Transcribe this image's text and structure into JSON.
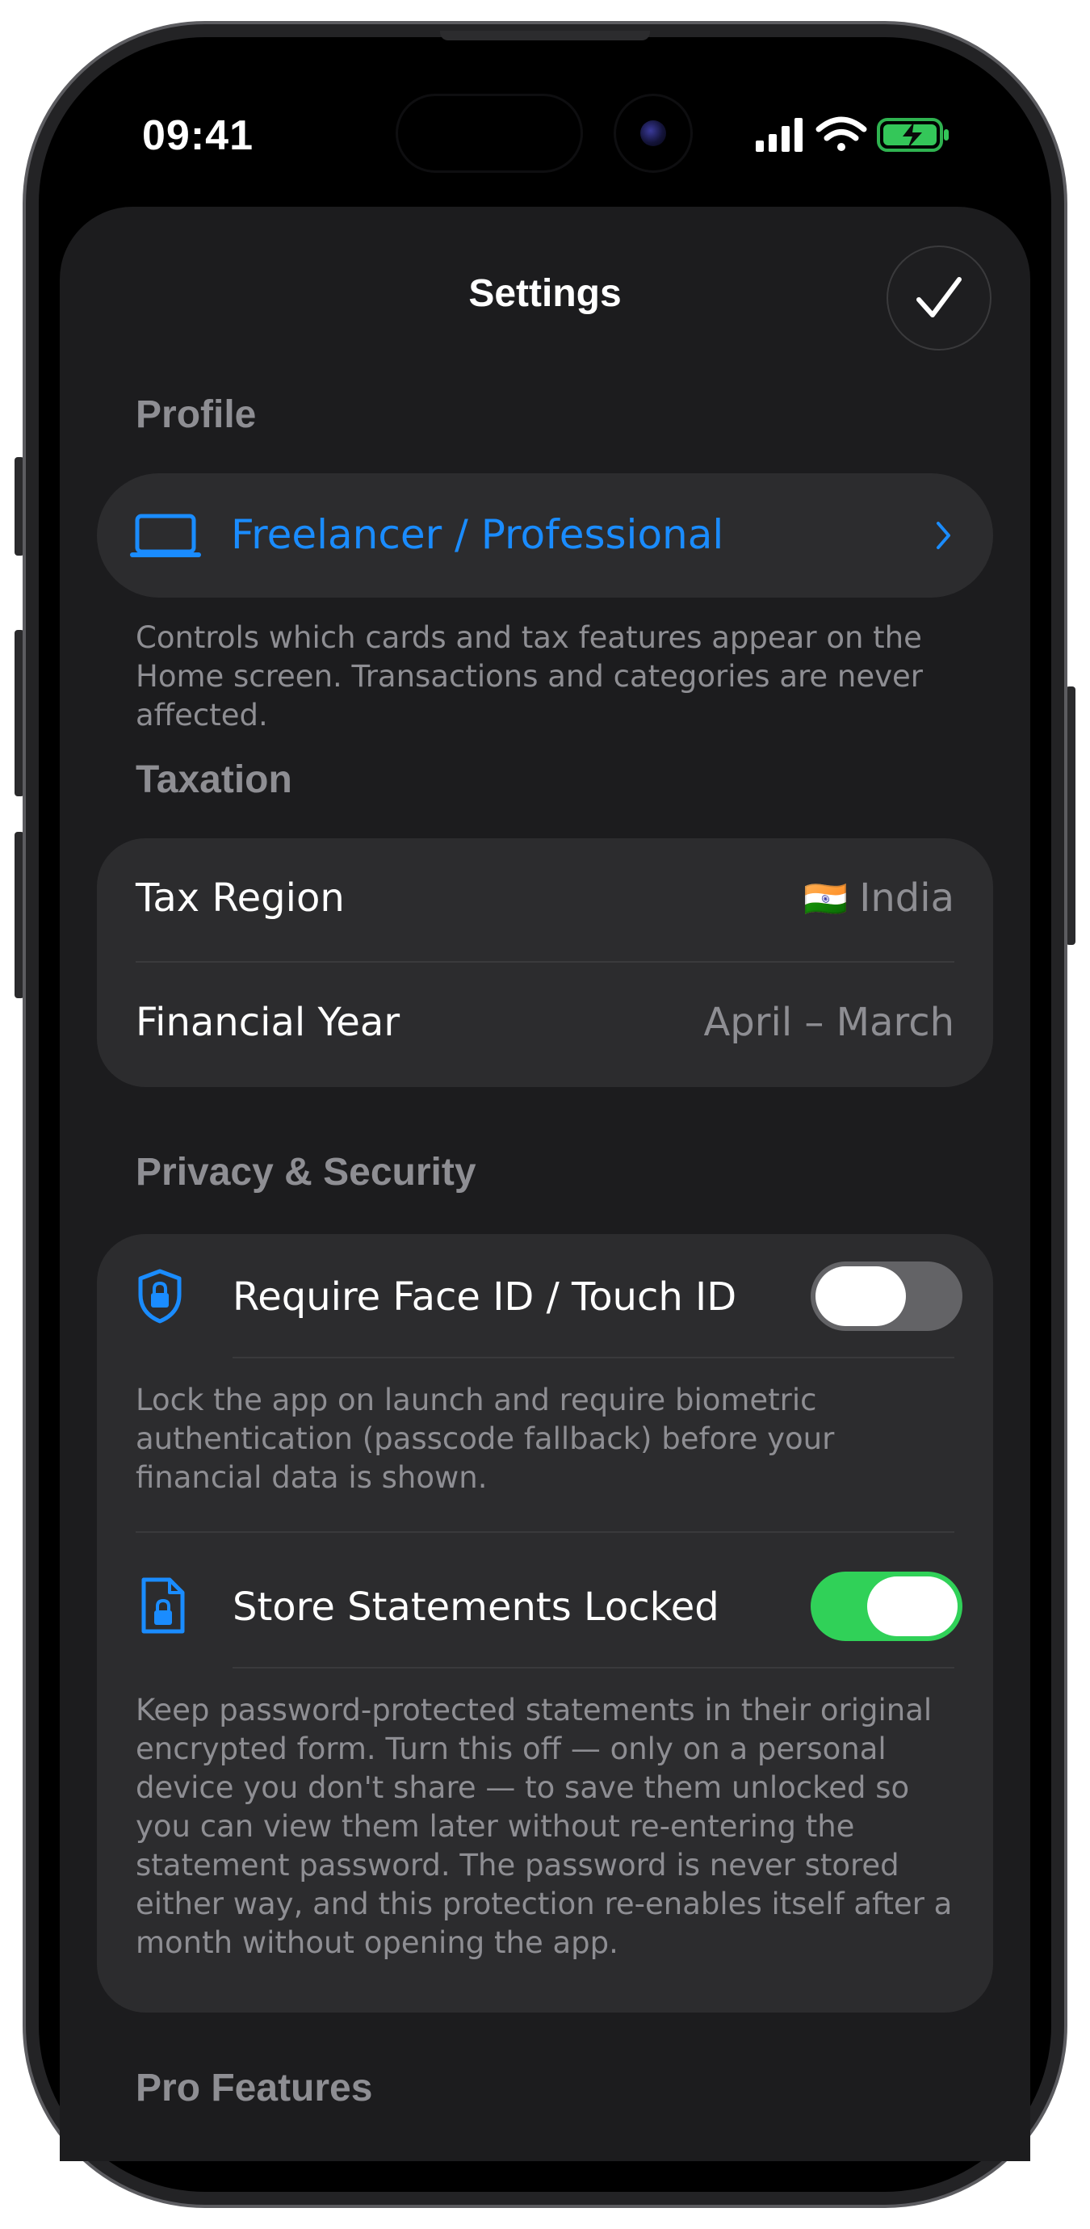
{
  "status_bar": {
    "time": "09:41"
  },
  "sheet": {
    "title": "Settings",
    "done_icon": "checkmark-icon"
  },
  "profile": {
    "header": "Profile",
    "selected": "Freelancer / Professional",
    "icon": "laptop-icon",
    "footnote": "Controls which cards and tax features appear on the Home screen. Transactions and categories are never affected."
  },
  "taxation": {
    "header": "Taxation",
    "rows": [
      {
        "label": "Tax Region",
        "flag": "🇮🇳",
        "value": "India"
      },
      {
        "label": "Financial Year",
        "value": "April – March"
      }
    ]
  },
  "privacy": {
    "header": "Privacy & Security",
    "items": [
      {
        "label": "Require Face ID / Touch ID",
        "icon": "shield-lock-icon",
        "enabled": false,
        "description": "Lock the app on launch and require biometric authentication (passcode fallback) before your financial data is shown."
      },
      {
        "label": "Store Statements Locked",
        "icon": "document-lock-icon",
        "enabled": true,
        "description": "Keep password-protected statements in their original encrypted form. Turn this off — only on a personal device you don't share — to save them unlocked so you can view them later without re-entering the statement password. The password is never stored either way, and this protection re-enables itself after a month without opening the app."
      }
    ]
  },
  "pro_features": {
    "header": "Pro Features"
  },
  "colors": {
    "accent": "#1a8cff",
    "toggle_on": "#30d158",
    "toggle_off": "#636366",
    "sheet_background": "#1c1c1e",
    "card_background": "#2c2c2e",
    "secondary_text": "#8e8e93"
  }
}
